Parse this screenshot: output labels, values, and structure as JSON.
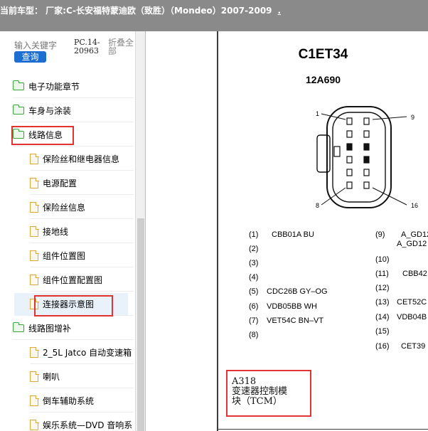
{
  "header": {
    "title": "当前车型：  厂家:C-长安福特蒙迪欧（致胜）（Mondeo）2007-2009",
    "trailing": "."
  },
  "search": {
    "placeholder": "输入关键字",
    "query_label": "查询",
    "pc_code": "PC.14-20963",
    "fold_all_label": "折叠全部"
  },
  "tree": {
    "items": [
      {
        "label": "电子功能章节",
        "icon": "folder-icon",
        "level": 0
      },
      {
        "label": "车身与涂装",
        "icon": "folder-icon",
        "level": 0
      },
      {
        "label": "线路信息",
        "icon": "folder-open-icon",
        "level": 0
      },
      {
        "label": "保险丝和继电器信息",
        "icon": "page-icon",
        "level": 1
      },
      {
        "label": "电源配置",
        "icon": "page-icon",
        "level": 1
      },
      {
        "label": "保险丝信息",
        "icon": "page-icon",
        "level": 1
      },
      {
        "label": "接地线",
        "icon": "page-icon",
        "level": 1
      },
      {
        "label": "组件位置图",
        "icon": "page-icon",
        "level": 1
      },
      {
        "label": "组件位置配置图",
        "icon": "page-icon",
        "level": 1
      },
      {
        "label": "连接器示意图",
        "icon": "page-icon",
        "level": 1
      },
      {
        "label": "线路图增补",
        "icon": "folder-open-icon",
        "level": 0
      },
      {
        "label": "2_5L Jatco 自动变速箱",
        "icon": "page-icon",
        "level": 1
      },
      {
        "label": "喇叭",
        "icon": "page-icon",
        "level": 1
      },
      {
        "label": "倒车辅助系统",
        "icon": "page-icon",
        "level": 1
      },
      {
        "label": "娱乐系统—DVD 音响系",
        "icon": "page-icon",
        "level": 1
      }
    ]
  },
  "document": {
    "connector_code": "C1ET34",
    "part_number": "12A690",
    "pin_labels": [
      "1",
      "9",
      "8",
      "16"
    ],
    "pins_left": [
      {
        "no": "(1)",
        "value": "CBB01A BU"
      },
      {
        "no": "(2)",
        "value": ""
      },
      {
        "no": "(3)",
        "value": ""
      },
      {
        "no": "(4)",
        "value": ""
      },
      {
        "no": "(5)",
        "value": "CDC26B GY–OG"
      },
      {
        "no": "(6)",
        "value": "VDB05BB WH"
      },
      {
        "no": "(7)",
        "value": "VET54C BN–VT"
      },
      {
        "no": "(8)",
        "value": ""
      }
    ],
    "pins_right": [
      {
        "no": "(9)",
        "value": "A_GD12"
      },
      {
        "no": "",
        "value": "A_GD12"
      },
      {
        "no": "(10)",
        "value": ""
      },
      {
        "no": "(11)",
        "value": "CBB42"
      },
      {
        "no": "(12)",
        "value": ""
      },
      {
        "no": "(13)",
        "value": "CET52C"
      },
      {
        "no": "(14)",
        "value": "VDB04B"
      },
      {
        "no": "(15)",
        "value": ""
      },
      {
        "no": "(16)",
        "value": "CET39"
      }
    ],
    "module_code": "A318",
    "module_name_line1": "变速器控制模",
    "module_name_line2": "块（TCM）"
  },
  "colors": {
    "highlight": "#e33232",
    "query_button": "#1c6fd1",
    "header_bg": "#8a8a8a"
  }
}
